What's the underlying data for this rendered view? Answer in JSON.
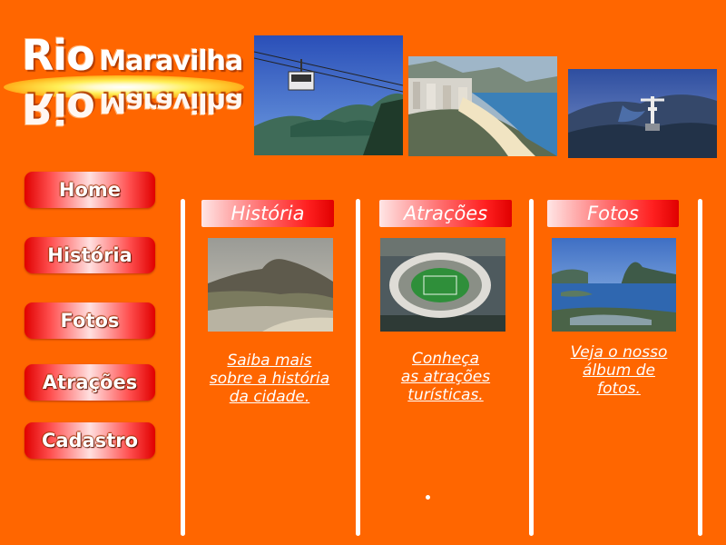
{
  "logo": {
    "title_word1": "Rio",
    "title_word2": "Maravilha",
    "reflection_word1": "Rio",
    "reflection_word2": "Maravilha"
  },
  "nav": {
    "items": [
      {
        "label": "Home"
      },
      {
        "label": "História"
      },
      {
        "label": "Fotos"
      },
      {
        "label": "Atrações"
      },
      {
        "label": "Cadastro"
      }
    ]
  },
  "sections": [
    {
      "title": "História",
      "link_lines": [
        "Saiba mais",
        "sobre a história",
        "da cidade."
      ]
    },
    {
      "title": "Atrações",
      "link_lines": [
        "Conheça",
        "as atrações",
        "turísticas."
      ]
    },
    {
      "title": "Fotos",
      "link_lines": [
        "Veja o nosso",
        "álbum de",
        "fotos."
      ]
    }
  ],
  "colors": {
    "background": "#ff6600",
    "button_red": "#e00000",
    "text": "#ffffff"
  },
  "icons": {
    "header_photos": [
      "cable-car-photo",
      "beach-photo",
      "christ-redeemer-photo"
    ],
    "thumbnails": [
      "mountain-photo",
      "stadium-photo",
      "bay-photo"
    ]
  }
}
